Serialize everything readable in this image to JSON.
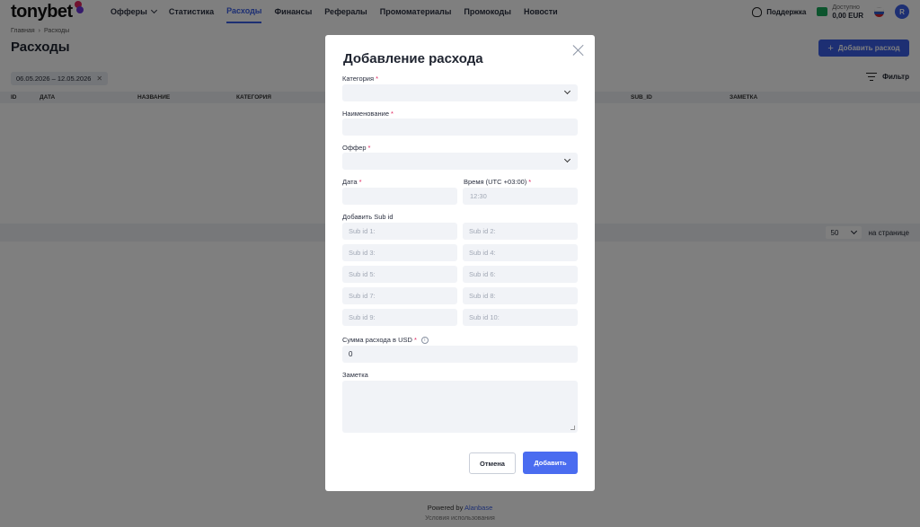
{
  "header": {
    "logo_text": "tonybet",
    "nav": [
      {
        "label": "Офферы",
        "has_dropdown": true
      },
      {
        "label": "Статистика"
      },
      {
        "label": "Расходы",
        "active": true
      },
      {
        "label": "Финансы"
      },
      {
        "label": "Рефералы"
      },
      {
        "label": "Промоматериалы"
      },
      {
        "label": "Промокоды"
      },
      {
        "label": "Новости"
      }
    ],
    "support_label": "Поддержка",
    "balance_label": "Доступно",
    "balance_value": "0,00 EUR",
    "avatar_initial": "R"
  },
  "breadcrumb": {
    "home": "Главная",
    "current": "Расходы"
  },
  "page": {
    "title": "Расходы",
    "add_button": "Добавить расход",
    "date_range": "06.05.2026 – 12.05.2026",
    "filter_label": "Фильтр",
    "columns": [
      "ID",
      "ДАТА",
      "НАЗВАНИЕ",
      "КАТЕГОРИЯ",
      "SUB_ID",
      "ЗАМЕТКА"
    ],
    "per_page_value": "50",
    "per_page_label": "на странице"
  },
  "footer": {
    "powered_by": "Powered by",
    "brand": "Alanbase",
    "terms": "Условия использования"
  },
  "modal": {
    "title": "Добавление расхода",
    "category_label": "Категория",
    "name_label": "Наименование",
    "offer_label": "Оффер",
    "date_label": "Дата",
    "time_label": "Время (UTC +03:00)",
    "time_placeholder": "12:30",
    "subid_section_label": "Добавить Sub id",
    "subids": [
      "Sub id 1:",
      "Sub id 2:",
      "Sub id 3:",
      "Sub id 4:",
      "Sub id 5:",
      "Sub id 6:",
      "Sub id 7:",
      "Sub id 8:",
      "Sub id 9:",
      "Sub id 10:"
    ],
    "amount_label": "Сумма расхода в USD",
    "amount_value": "0",
    "note_label": "Заметка",
    "cancel_button": "Отмена",
    "submit_button": "Добавить",
    "required_mark": "*",
    "info_glyph": "i"
  },
  "colors": {
    "accent": "#3a5ee6",
    "required": "#e0245e",
    "overlay": "rgba(0,0,0,0.5)"
  }
}
